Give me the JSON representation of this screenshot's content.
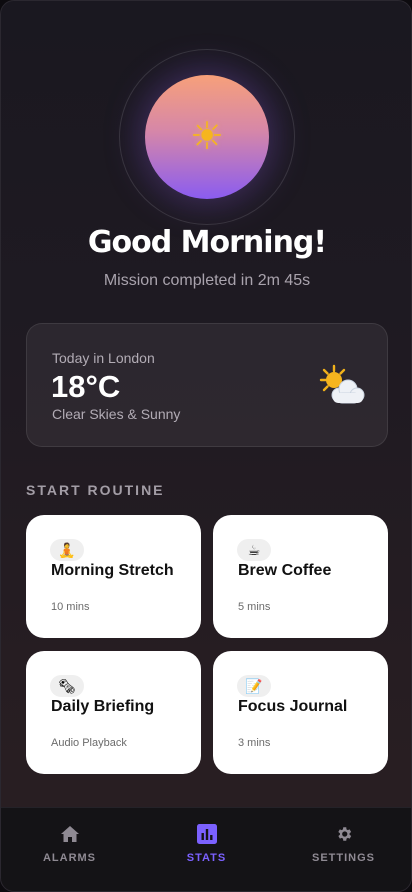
{
  "hero": {
    "greeting": "Good Morning!",
    "subtitle": "Mission completed in 2m 45s",
    "icon": "sun-icon"
  },
  "weather": {
    "location_label": "Today in London",
    "temperature": "18°C",
    "condition": "Clear Skies & Sunny",
    "icon": "sun-behind-cloud-icon"
  },
  "routine": {
    "section_label": "START ROUTINE",
    "cards": [
      {
        "emoji": "🧘",
        "icon": "meditation-icon",
        "title": "Morning Stretch",
        "meta": "10 mins"
      },
      {
        "emoji": "☕",
        "icon": "coffee-icon",
        "title": "Brew Coffee",
        "meta": "5 mins"
      },
      {
        "emoji": "🗞",
        "icon": "newspaper-icon",
        "title": "Daily Briefing",
        "meta": "Audio Playback"
      },
      {
        "emoji": "📝",
        "icon": "memo-icon",
        "title": "Focus Journal",
        "meta": "3 mins"
      }
    ]
  },
  "nav": {
    "items": [
      {
        "label": "ALARMS",
        "icon": "home-icon",
        "active": false
      },
      {
        "label": "STATS",
        "icon": "stats-icon",
        "active": true
      },
      {
        "label": "SETTINGS",
        "icon": "gear-icon",
        "active": false
      }
    ],
    "accent": "#7b61ff"
  },
  "colors": {
    "sun_gradient_top": "#f7a07a",
    "sun_gradient_bottom": "#8a5cf0",
    "card_bg": "#ffffff"
  }
}
